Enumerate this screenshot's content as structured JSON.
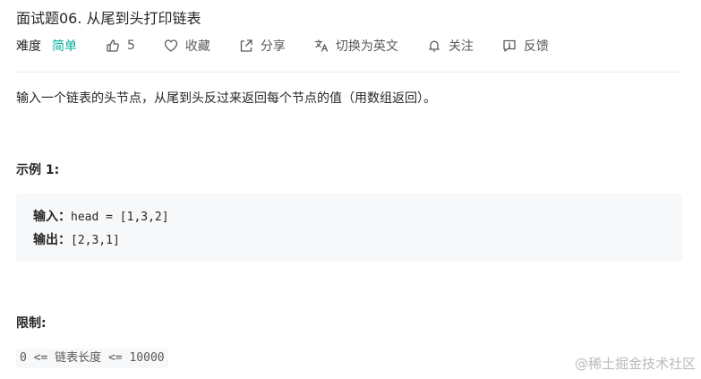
{
  "problem": {
    "title": "面试题06. 从尾到头打印链表",
    "difficulty_label": "难度",
    "difficulty_value": "简单",
    "likes_count": "5",
    "favorite_label": "收藏",
    "share_label": "分享",
    "translate_label": "切换为英文",
    "follow_label": "关注",
    "feedback_label": "反馈"
  },
  "description": "输入一个链表的头节点，从尾到头反过来返回每个节点的值（用数组返回）。",
  "example": {
    "title": "示例 1:",
    "input_label": "输入：",
    "input_value": "head = [1,3,2]",
    "output_label": "输出：",
    "output_value": "[2,3,1]"
  },
  "limits": {
    "title": "限制:",
    "constraint_prefix": "0 <= ",
    "constraint_cjk": "链表长度",
    "constraint_suffix": " <= 10000"
  },
  "watermark": "@稀土掘金技术社区",
  "colors": {
    "easy": "#00af9b",
    "text": "#262626",
    "muted": "#595959",
    "code_bg": "#f7f8fa"
  }
}
